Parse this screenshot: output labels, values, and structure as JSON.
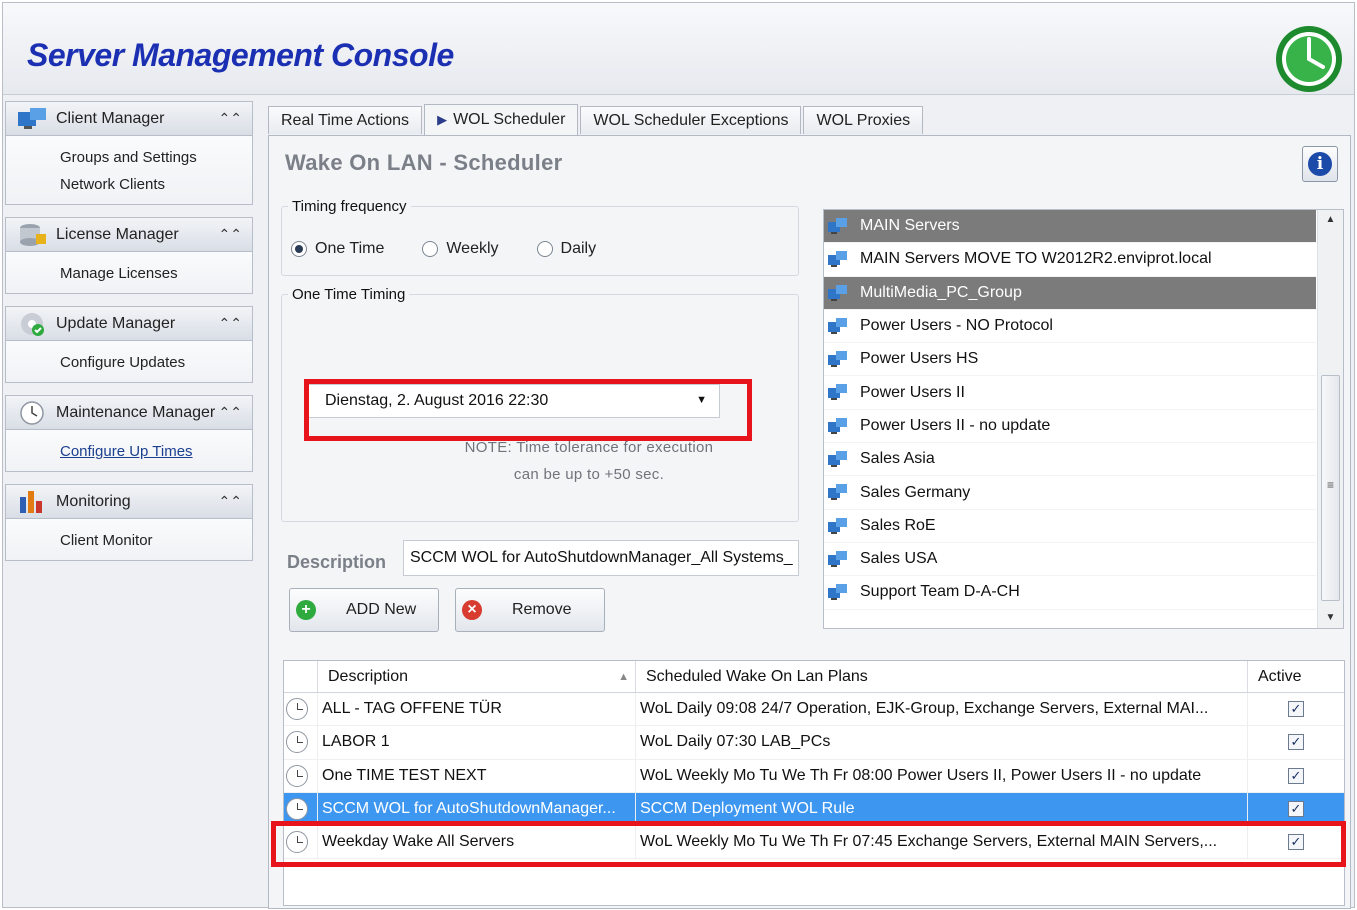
{
  "app": {
    "title": "Server Management Console"
  },
  "sidebar": {
    "groups": [
      {
        "label": "Client Manager",
        "items": [
          "Groups and Settings",
          "Network Clients"
        ]
      },
      {
        "label": "License Manager",
        "items": [
          "Manage Licenses"
        ]
      },
      {
        "label": "Update  Manager",
        "items": [
          "Configure Updates"
        ]
      },
      {
        "label": "Maintenance Manager",
        "items": [
          "Configure Up Times"
        ]
      },
      {
        "label": "Monitoring",
        "items": [
          "Client Monitor"
        ]
      }
    ],
    "collapse_glyph": "⌃⌃"
  },
  "tabs": [
    {
      "label": "Real Time Actions"
    },
    {
      "label": "WOL Scheduler",
      "active": true
    },
    {
      "label": "WOL Scheduler Exceptions"
    },
    {
      "label": "WOL Proxies"
    }
  ],
  "panel": {
    "title": "Wake On LAN - Scheduler",
    "info_icon": "i",
    "timing_frequency": {
      "legend": "Timing frequency",
      "options": [
        "One Time",
        "Weekly",
        "Daily"
      ],
      "selected": "One Time"
    },
    "one_time_timing": {
      "legend": "One Time Timing",
      "datetime": "Dienstag, 2. August 2016 22:30",
      "note_line1": "NOTE: Time tolerance  for execution",
      "note_line2": "can be up to +50 sec."
    },
    "description": {
      "label": "Description",
      "value": "SCCM WOL for AutoShutdownManager_All Systems_"
    },
    "buttons": {
      "add": "ADD New",
      "remove": "Remove"
    }
  },
  "group_list": {
    "items": [
      {
        "label": "MAIN Servers",
        "selected": true
      },
      {
        "label": "MAIN Servers MOVE TO W2012R2.enviprot.local",
        "selected": false
      },
      {
        "label": "MultiMedia_PC_Group",
        "selected": true
      },
      {
        "label": "Power Users - NO Protocol",
        "selected": false
      },
      {
        "label": "Power Users HS",
        "selected": false
      },
      {
        "label": "Power Users II",
        "selected": false
      },
      {
        "label": "Power Users II - no update",
        "selected": false
      },
      {
        "label": "Sales Asia",
        "selected": false
      },
      {
        "label": "Sales Germany",
        "selected": false
      },
      {
        "label": "Sales RoE",
        "selected": false
      },
      {
        "label": "Sales USA",
        "selected": false
      },
      {
        "label": "Support Team D-A-CH",
        "selected": false
      }
    ]
  },
  "grid": {
    "columns": {
      "description": "Description",
      "plans": "Scheduled Wake On Lan Plans",
      "active": "Active"
    },
    "rows": [
      {
        "description": "ALL - TAG OFFENE TÜR",
        "plan": "WoL Daily   09:08  24/7 Operation, EJK-Group, Exchange Servers, External MAI...",
        "active": true,
        "selected": false
      },
      {
        "description": "LABOR 1",
        "plan": "WoL Daily   07:30  LAB_PCs",
        "active": true,
        "selected": false
      },
      {
        "description": "One TIME TEST NEXT",
        "plan": "WoL Weekly Mo Tu We Th Fr  08:00  Power Users II, Power Users II - no update",
        "active": true,
        "selected": false
      },
      {
        "description": "SCCM WOL for AutoShutdownManager...",
        "plan": "SCCM Deployment WOL Rule",
        "active": true,
        "selected": true
      },
      {
        "description": "Weekday Wake All Servers",
        "plan": "WoL Weekly Mo Tu We Th Fr  07:45  Exchange Servers, External MAIN Servers,...",
        "active": true,
        "selected": false
      }
    ]
  },
  "colors": {
    "highlight_red": "#e8141c",
    "selection_blue": "#3d97f0",
    "title_blue": "#1b2fb3"
  }
}
